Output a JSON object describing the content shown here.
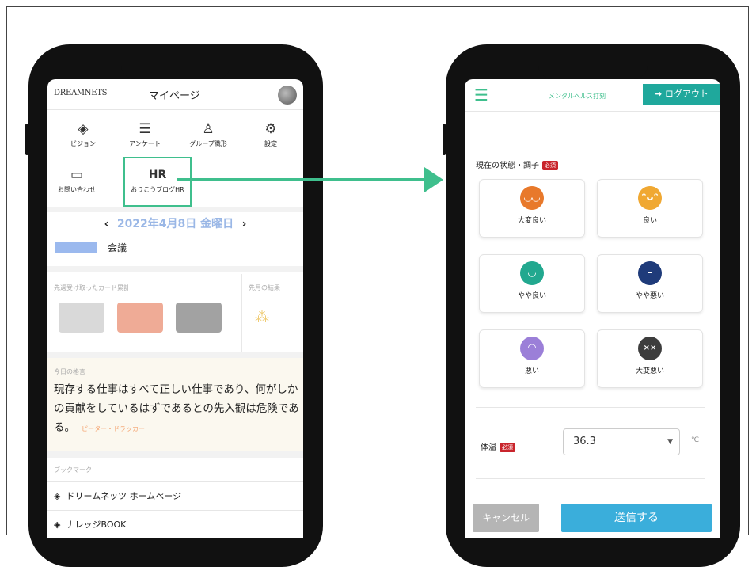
{
  "left": {
    "logo": "DREAMNETS",
    "page_title": "マイページ",
    "nav": [
      {
        "label": "ビジョン",
        "icon": "compass-icon"
      },
      {
        "label": "アンケート",
        "icon": "survey-icon"
      },
      {
        "label": "グループ職形",
        "icon": "group-icon"
      },
      {
        "label": "設定",
        "icon": "gear-icon"
      },
      {
        "label": "お問い合わせ",
        "icon": "chat-icon"
      },
      {
        "label": "おりこうブログHR",
        "icon": "hr-icon",
        "icon_text": "HR"
      }
    ],
    "date": {
      "prev": "‹",
      "value": "2022年4月8日 金曜日",
      "next": "›"
    },
    "today_badge": "",
    "meeting": "会議",
    "cards_title": "先週受け取ったカード累計",
    "month_title": "先月の結果",
    "quote_small": "今日の格言",
    "quote": "現存する仕事はすべて正しい仕事であり、何がしかの貢献をしているはずであるとの先入観は危険である。",
    "author": "ピーター・ドラッカー",
    "bookmark_title": "ブックマーク",
    "bookmarks": [
      "ドリームネッツ ホームページ",
      "ナレッジBOOK"
    ]
  },
  "right": {
    "header_title": "メンタルヘルス打刻",
    "logout": "ログアウト",
    "status_label": "現在の状態・調子",
    "required": "必須",
    "moods": [
      {
        "label": "大変良い",
        "color": "#e8792b"
      },
      {
        "label": "良い",
        "color": "#f0a832"
      },
      {
        "label": "やや良い",
        "color": "#22a88f"
      },
      {
        "label": "やや悪い",
        "color": "#1f3b7a"
      },
      {
        "label": "悪い",
        "color": "#9b7fd8"
      },
      {
        "label": "大変悪い",
        "color": "#3d3d3d"
      }
    ],
    "temp_label": "体温",
    "temp_value": "36.3",
    "temp_unit": "℃",
    "cancel": "キャンセル",
    "submit": "送信する"
  }
}
